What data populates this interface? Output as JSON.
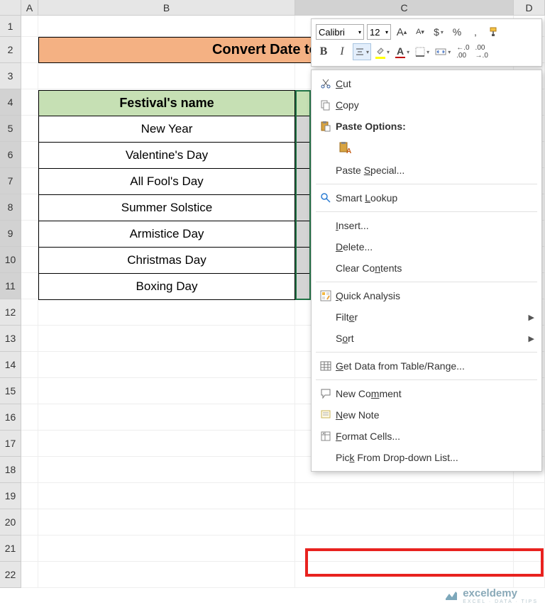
{
  "columns": {
    "A": "A",
    "B": "B",
    "C": "C",
    "D": "D"
  },
  "rows": [
    "1",
    "2",
    "3",
    "4",
    "5",
    "6",
    "7",
    "8",
    "9",
    "10",
    "11",
    "12",
    "13",
    "14",
    "15",
    "16",
    "17",
    "18",
    "19",
    "20",
    "21",
    "22"
  ],
  "banner": "Convert Date to Da",
  "table": {
    "header": "Festival's name",
    "items": [
      "New Year",
      "Valentine's Day",
      "All Fool's Day",
      "Summer Solstice",
      "Armistice Day",
      "Christmas Day",
      "Boxing Day"
    ]
  },
  "mini": {
    "font": "Calibri",
    "size": "12",
    "grow": "A",
    "shrink": "A",
    "currency": "$",
    "percent": "%",
    "comma": ",",
    "bold": "B",
    "italic": "I",
    "fontcolor": "A",
    "decInc": ".00",
    "decDec": ".0"
  },
  "menu": {
    "cut": "Cut",
    "copy": "Copy",
    "paste_options": "Paste Options:",
    "paste_special": "Paste Special...",
    "smart_lookup": "Smart Lookup",
    "insert": "Insert...",
    "delete": "Delete...",
    "clear": "Clear Contents",
    "quick": "Quick Analysis",
    "filter": "Filter",
    "sort": "Sort",
    "getdata": "Get Data from Table/Range...",
    "comment": "New Comment",
    "note": "New Note",
    "format": "Format Cells...",
    "pick": "Pick From Drop-down List..."
  },
  "watermark": {
    "brand": "exceldemy",
    "tag": "EXCEL · DATA · TIPS"
  }
}
